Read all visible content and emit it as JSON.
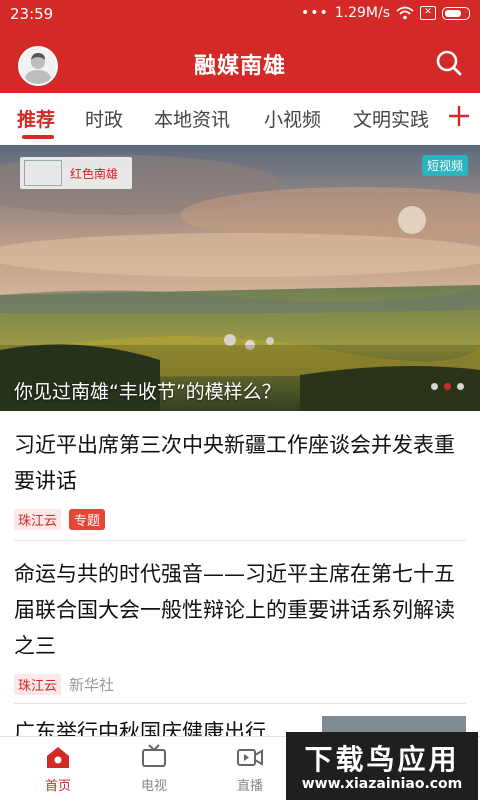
{
  "status_bar": {
    "time": "23:59",
    "network": "1.29M/s"
  },
  "header": {
    "title": "融媒南雄"
  },
  "tabs": [
    {
      "label": "推荐",
      "active": true
    },
    {
      "label": "时政"
    },
    {
      "label": "本地资讯"
    },
    {
      "label": "小视频"
    },
    {
      "label": "文明实践"
    }
  ],
  "banner": {
    "logo_text": "红色南雄",
    "badge": "短视频",
    "caption": "你见过南雄“丰收节”的模样么？",
    "page_count": 3,
    "active_page": 2
  },
  "news": [
    {
      "title": "习近平出席第三次中央新疆工作座谈会并发表重要讲话",
      "source_tag": "珠江云",
      "topic_tag": "专题"
    },
    {
      "title": "命运与共的时代强音——习近平主席在第七十五届联合国大会一般性辩论上的重要讲话系列解读之三",
      "source_tag": "珠江云",
      "author": "新华社"
    }
  ],
  "peek_title": "广东举行中秋国庆健康出行",
  "bottom_nav": [
    {
      "label": "首页",
      "icon": "home-icon",
      "active": true
    },
    {
      "label": "电视",
      "icon": "tv-icon"
    },
    {
      "label": "直播",
      "icon": "live-icon"
    }
  ],
  "watermark": {
    "main": "下载鸟应用",
    "url": "www.xiazainiao.com"
  },
  "colors": {
    "brand_red": "#d32a27",
    "badge_teal": "#2bb3c0"
  }
}
